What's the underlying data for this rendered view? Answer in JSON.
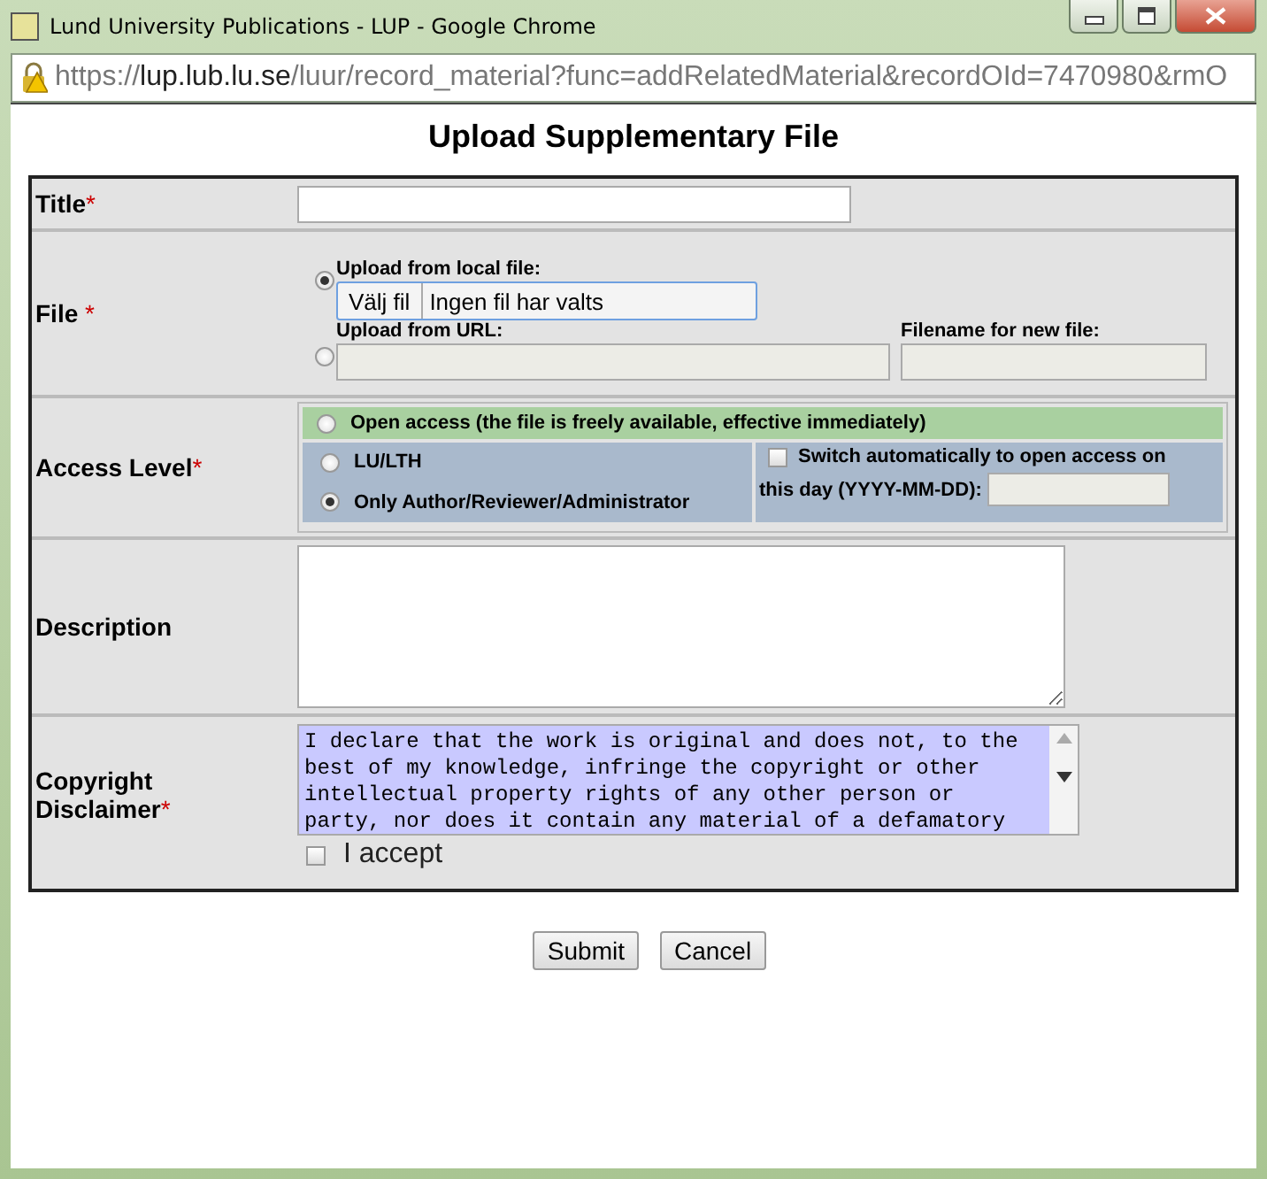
{
  "window": {
    "title": "Lund University Publications - LUP - Google Chrome"
  },
  "address": {
    "scheme": "https://",
    "host": "lup.lub.lu.se",
    "path": "/luur/record_material?func=addRelatedMaterial&recordOId=7470980&rmO"
  },
  "heading": "Upload Supplementary File",
  "form": {
    "title_field": {
      "label": "Title",
      "required_mark": "*"
    },
    "file": {
      "label": "File",
      "required_mark": "*",
      "options": [
        {
          "label": "Upload from local file:",
          "selected": true
        },
        {
          "label": "Upload from URL:",
          "selected": false
        }
      ],
      "choose_button": "Välj fil",
      "no_file_text": "Ingen fil har valts",
      "filename_label": "Filename for new file:"
    },
    "access": {
      "label": "Access Level",
      "required_mark": "*",
      "options": [
        {
          "label": "Open access (the file is freely available, effective immediately)",
          "selected": false
        },
        {
          "label": "LU/LTH",
          "selected": false
        },
        {
          "label": "Only Author/Reviewer/Administrator",
          "selected": true
        }
      ],
      "auto_switch": {
        "label": "Switch automatically to open access on",
        "date_label": "this day (YYYY-MM-DD):",
        "checked": false
      }
    },
    "description": {
      "label": "Description"
    },
    "copyright": {
      "label": "Copyright Disclaimer",
      "required_mark": "*",
      "text": "I declare that the work is original and does not, to the\nbest of my knowledge, infringe the copyright or other\nintellectual property rights of any other person or\nparty, nor does it contain any material of a defamatory",
      "accept": {
        "label": "I accept",
        "checked": false
      }
    }
  },
  "buttons": [
    "Submit",
    "Cancel"
  ]
}
